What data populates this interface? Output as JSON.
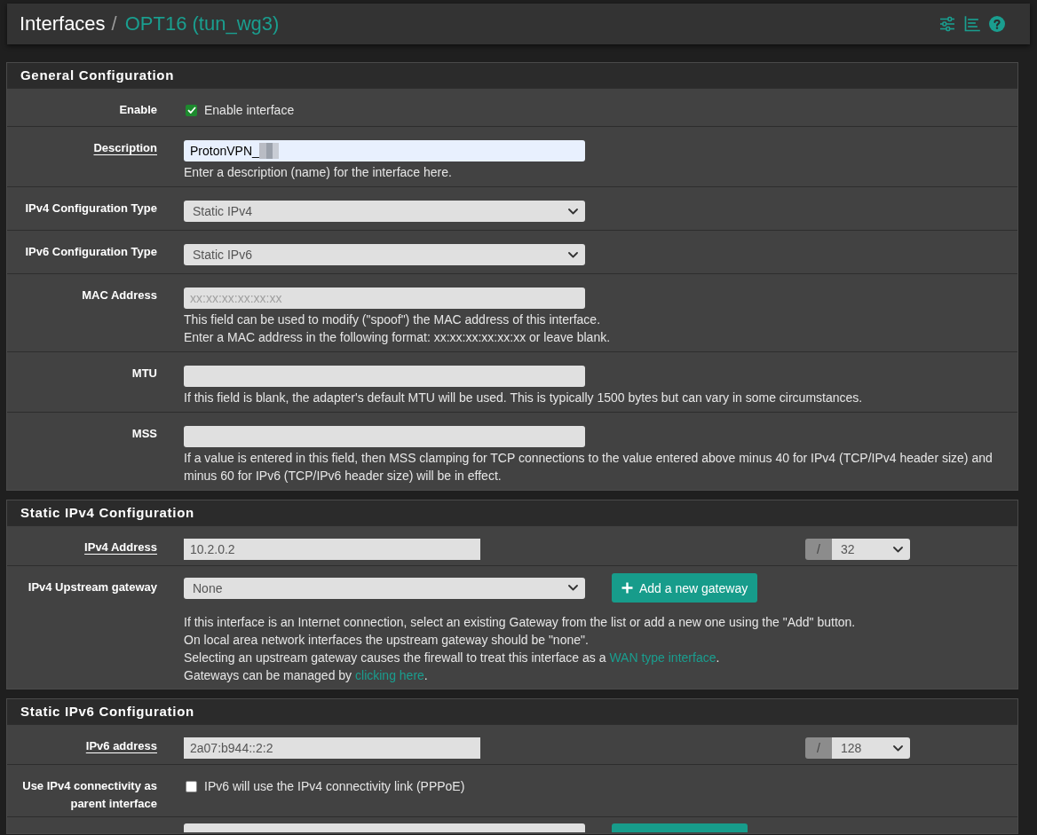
{
  "header": {
    "breadcrumb": [
      "Interfaces",
      "OPT16 (tun_wg3)"
    ],
    "separator": "/"
  },
  "sections": [
    {
      "title": "General Configuration",
      "rows": [
        {
          "kind": "checkbox",
          "label": "Enable",
          "required": false,
          "checked": true,
          "text": "Enable interface"
        },
        {
          "kind": "text",
          "label": "Description",
          "required": true,
          "value": "ProtonVPN_",
          "redacted": true,
          "autofilled": true,
          "help": [
            "Enter a description (name) for the interface here."
          ]
        },
        {
          "kind": "select",
          "label": "IPv4 Configuration Type",
          "required": false,
          "value": "Static IPv4"
        },
        {
          "kind": "select",
          "label": "IPv6 Configuration Type",
          "required": false,
          "value": "Static IPv6"
        },
        {
          "kind": "text",
          "label": "MAC Address",
          "required": false,
          "placeholder": "xx:xx:xx:xx:xx:xx",
          "autofilled": false,
          "help": [
            "This field can be used to modify (\"spoof\") the MAC address of this interface.",
            "Enter a MAC address in the following format: xx:xx:xx:xx:xx:xx or leave blank."
          ]
        },
        {
          "kind": "text",
          "label": "MTU",
          "required": false,
          "autofilled": false,
          "help": [
            "If this field is blank, the adapter's default MTU will be used. This is typically 1500 bytes but can vary in some circumstances."
          ]
        },
        {
          "kind": "text",
          "label": "MSS",
          "required": false,
          "autofilled": false,
          "help": [
            "If a value is entered in this field, then MSS clamping for TCP connections to the value entered above minus 40 for IPv4 (TCP/IPv4 header size) and minus 60 for IPv6 (TCP/IPv6 header size) will be in effect."
          ]
        }
      ]
    },
    {
      "title": "Static IPv4 Configuration",
      "rows": [
        {
          "kind": "address",
          "label": "IPv4 Address",
          "required": true,
          "value": "10.2.0.2",
          "separator": "/",
          "prefix": "32"
        },
        {
          "kind": "gateway",
          "label": "IPv4 Upstream gateway",
          "required": false,
          "value": "None",
          "button": "Add a new gateway",
          "help": [
            "If this interface is an Internet connection, select an existing Gateway from the list or add a new one using the \"Add\" button.",
            "On local area network interfaces the upstream gateway should be \"none\".",
            {
              "before": "Selecting an upstream gateway causes the firewall to treat this interface as a ",
              "link": "WAN type interface",
              "after": "."
            },
            {
              "before": "Gateways can be managed by ",
              "link": "clicking here",
              "after": "."
            }
          ]
        }
      ]
    },
    {
      "title": "Static IPv6 Configuration",
      "rows": [
        {
          "kind": "address",
          "label": "IPv6 address",
          "required": true,
          "value": "2a07:b944::2:2",
          "separator": "/",
          "prefix": "128"
        },
        {
          "kind": "checkbox",
          "label": "Use IPv4 connectivity as parent interface",
          "required": false,
          "checked": false,
          "text": "IPv6 will use the IPv4 connectivity link (PPPoE)"
        },
        {
          "kind": "cut"
        }
      ]
    }
  ]
}
